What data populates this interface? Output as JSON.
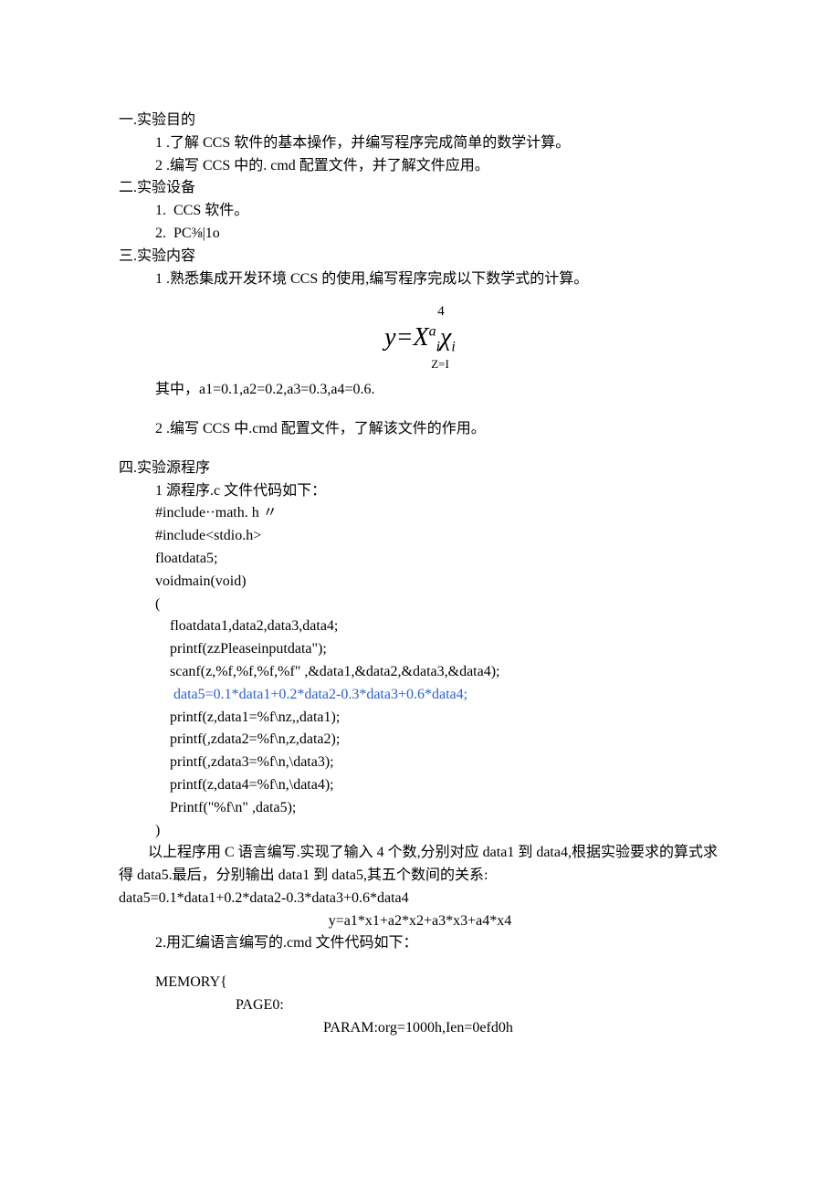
{
  "s1": {
    "heading": "一.实验目的",
    "item1": "1 .了解 CCS 软件的基本操作，并编写程序完成简单的数学计算。",
    "item2": "2 .编写 CCS 中的. cmd 配置文件，并了解文件应用。"
  },
  "s2": {
    "heading": "二.实验设备",
    "item1": "1.  CCS 软件。",
    "item2": "2.  PC⅜|1o"
  },
  "s3": {
    "heading": "三.实验内容",
    "item1": "1 .熟悉集成开发环境 CCS 的使用,编写程序完成以下数学式的计算。",
    "formula_top": "4",
    "formula_main_y": "y=",
    "formula_main_x": "X",
    "formula_sup": "a",
    "formula_sub1": "i",
    "formula_chi": "χ",
    "formula_sub2": "i",
    "formula_bottom": "Z=I",
    "coeffs": "其中，a1=0.1,a2=0.2,a3=0.3,a4=0.6.",
    "item2": "2 .编写 CCS 中.cmd 配置文件，了解该文件的作用。"
  },
  "s4": {
    "heading": "四.实验源程序",
    "intro": "1 源程序.c 文件代码如下：",
    "code": {
      "l1": "#include··math. h 〃",
      "l2": "#include<stdio.h>",
      "l3": "floatdata5;",
      "l4": "voidmain(void)",
      "l5": "(",
      "l6": "floatdata1,data2,data3,data4;",
      "l7": "printf(zzPleaseinputdata\");",
      "l8": "scanf(z,%f,%f,%f,%f\" ,&data1,&data2,&data3,&data4);",
      "l9": " data5=0.1*data1+0.2*data2-0.3*data3+0.6*data4;",
      "l10": "printf(z,data1=%f\\nz,,data1);",
      "l11": "printf(,zdata2=%f\\n,z,data2);",
      "l12": "printf(,zdata3=%f\\n,\\data3);",
      "l13": "printf(z,data4=%f\\n,\\data4);",
      "l14": "Printf(\"%f\\n\" ,data5);",
      "l15": ")"
    },
    "explain1": "以上程序用 C 语言编写.实现了输入 4 个数,分别对应 data1 到 data4,根据实验要求的算式求得 data5.最后，分别输出 data1 到 data5,其五个数间的关系:",
    "explain2": "data5=0.1*data1+0.2*data2-0.3*data3+0.6*data4",
    "explain3": "y=a1*x1+a2*x2+a3*x3+a4*x4",
    "intro2": "2.用汇编语言编写的.cmd 文件代码如下：",
    "mem": {
      "l1": "MEMORY{",
      "l2": "PAGE0:",
      "l3": "PARAM:org=1000h,Ien=0efd0h"
    }
  }
}
